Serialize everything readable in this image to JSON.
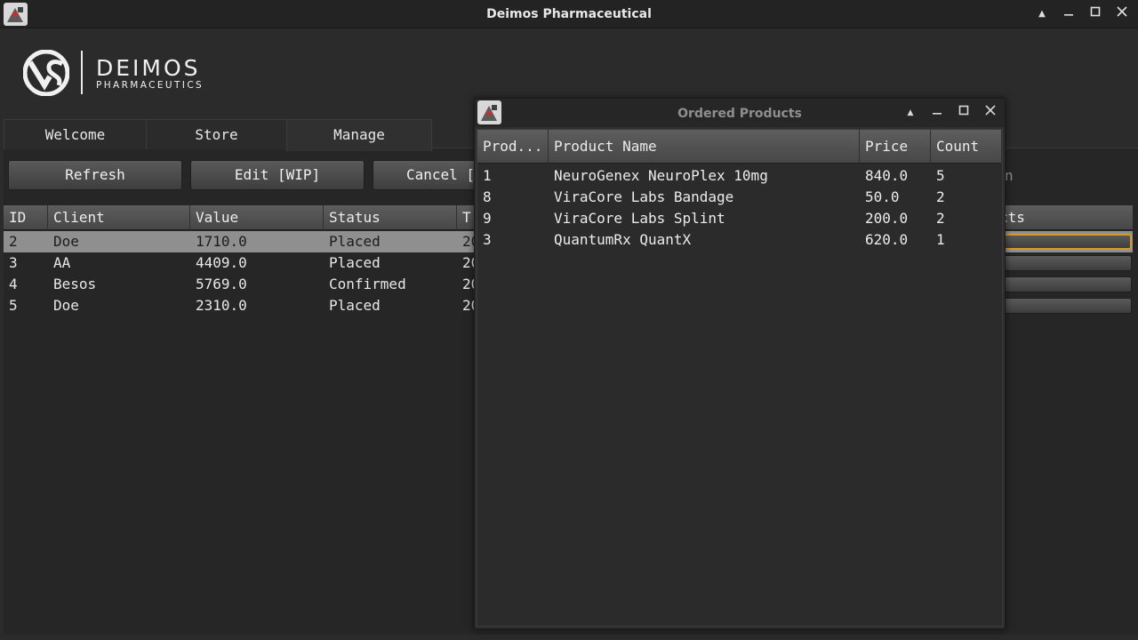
{
  "window": {
    "title": "Deimos Pharmaceutical",
    "icons": [
      "app-icon",
      "chevron-up-icon",
      "minimize-icon",
      "maximize-icon",
      "close-icon"
    ]
  },
  "logo": {
    "name": "DEIMOS",
    "subtitle": "PHARMACEUTICS"
  },
  "tabs": [
    {
      "label": "Welcome"
    },
    {
      "label": "Store"
    },
    {
      "label": "Manage"
    }
  ],
  "toolbar": {
    "refresh_label": "Refresh",
    "edit_label": "Edit [WIP]",
    "cancel_label": "Cancel [",
    "hidden_right_text": "n"
  },
  "orders_table": {
    "headers": [
      "ID",
      "Client",
      "Value",
      "Status",
      "T",
      "cts"
    ],
    "rows": [
      {
        "id": "2",
        "client": "Doe",
        "value": "1710.0",
        "status": "Placed",
        "t": "20"
      },
      {
        "id": "3",
        "client": "AA",
        "value": "4409.0",
        "status": "Placed",
        "t": "20"
      },
      {
        "id": "4",
        "client": "Besos",
        "value": "5769.0",
        "status": "Confirmed",
        "t": "20"
      },
      {
        "id": "5",
        "client": "Doe",
        "value": "2310.0",
        "status": "Placed",
        "t": "20"
      }
    ],
    "selected_row": 0
  },
  "dialog": {
    "title": "Ordered Products",
    "headers": [
      "Prod...",
      "Product Name",
      "Price",
      "Count"
    ],
    "rows": [
      {
        "id": "1",
        "name": "NeuroGenex NeuroPlex 10mg",
        "price": "840.0",
        "count": "5"
      },
      {
        "id": "8",
        "name": "ViraCore Labs Bandage",
        "price": "50.0",
        "count": "2"
      },
      {
        "id": "9",
        "name": "ViraCore Labs Splint",
        "price": "200.0",
        "count": "2"
      },
      {
        "id": "3",
        "name": "QuantumRx QuantX",
        "price": "620.0",
        "count": "1"
      }
    ]
  },
  "colors": {
    "background": "#2b2b2b",
    "titlebar": "#232323",
    "selected_row": "#8f8f8f",
    "focus_ring": "#d69a2a"
  }
}
